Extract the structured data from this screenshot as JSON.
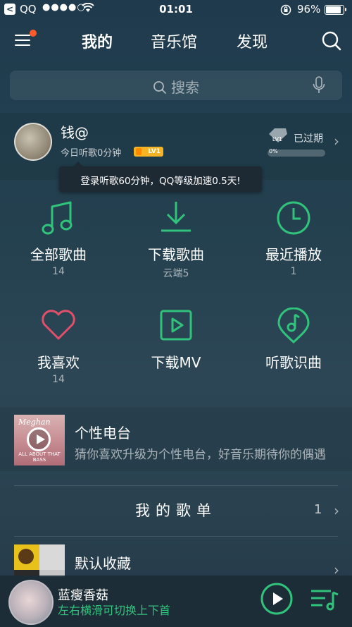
{
  "status_bar": {
    "back_glyph": "<",
    "carrier": "QQ",
    "signal": "●●●●○",
    "time": "01:01",
    "battery": "96%",
    "battery_level": 0.96
  },
  "header": {
    "tabs": [
      {
        "label": "我的",
        "active": true
      },
      {
        "label": "音乐馆",
        "active": false
      },
      {
        "label": "发现",
        "active": false
      }
    ],
    "menu_has_badge": true
  },
  "search": {
    "placeholder": "搜索"
  },
  "profile": {
    "name": "钱@",
    "listen_today": "今日听歌0分钟",
    "level_badge": "LV1",
    "vip_badge": "LV1",
    "vip_status": "已过期",
    "vip_progress_label": "0%",
    "vip_progress": 0,
    "tooltip": "登录听歌60分钟，QQ等级加速0.5天!"
  },
  "grid": [
    {
      "label": "全部歌曲",
      "count": "14",
      "icon": "music-note-icon"
    },
    {
      "label": "下载歌曲",
      "count": "云端5",
      "icon": "download-icon"
    },
    {
      "label": "最近播放",
      "count": "1",
      "icon": "clock-icon"
    },
    {
      "label": "我喜欢",
      "count": "14",
      "icon": "heart-icon"
    },
    {
      "label": "下载MV",
      "count": "",
      "icon": "mv-play-icon"
    },
    {
      "label": "听歌识曲",
      "count": "",
      "icon": "recognize-song-icon"
    }
  ],
  "radio": {
    "title": "个性电台",
    "description": "猜你喜欢升级为个性电台，好音乐期待你的偶遇",
    "cover_title": "Meghan",
    "cover_subtitle": "ALL ABOUT THAT BASS"
  },
  "playlists": {
    "header": "我的歌单",
    "count": "1",
    "items": [
      {
        "title": "默认收藏"
      }
    ]
  },
  "player": {
    "title": "蓝瘦香菇",
    "hint": "左右横滑可切换上下首"
  },
  "colors": {
    "accent": "#31c27c",
    "badge": "#ff5a2a",
    "heart": "#e0506a",
    "level": "#f5b423"
  }
}
